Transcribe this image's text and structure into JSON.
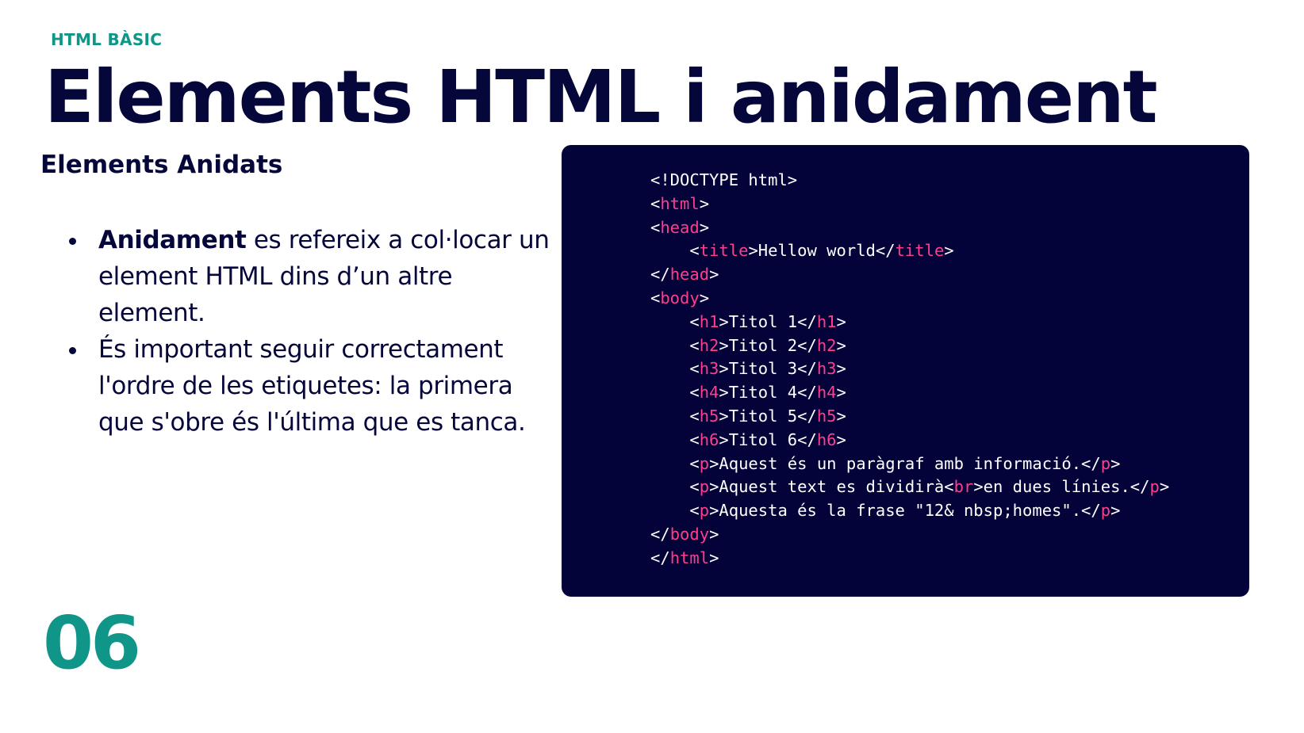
{
  "header": {
    "kicker": "HTML BÀSIC",
    "title": "Elements HTML i anidament"
  },
  "content": {
    "subtitle": "Elements Anidats",
    "bullets": [
      {
        "bold": "Anidament",
        "text": " es refereix a col·locar un element HTML dins d’un altre element."
      },
      {
        "bold": "",
        "text": "És important seguir correctament l'ordre de les etiquetes: la primera que s'obre és l'última que es tanca."
      }
    ]
  },
  "code_block": {
    "lines": [
      [
        "<!DOCTYPE html>"
      ],
      [
        "<",
        {
          "tag": "html"
        },
        ">"
      ],
      [
        "<",
        {
          "tag": "head"
        },
        ">"
      ],
      [
        "    <",
        {
          "tag": "title"
        },
        ">Hellow world</",
        {
          "tag": "title"
        },
        ">"
      ],
      [
        "</",
        {
          "tag": "head"
        },
        ">"
      ],
      [
        "<",
        {
          "tag": "body"
        },
        ">"
      ],
      [
        "    <",
        {
          "tag": "h1"
        },
        ">Titol 1</",
        {
          "tag": "h1"
        },
        ">"
      ],
      [
        "    <",
        {
          "tag": "h2"
        },
        ">Titol 2</",
        {
          "tag": "h2"
        },
        ">"
      ],
      [
        "    <",
        {
          "tag": "h3"
        },
        ">Titol 3</",
        {
          "tag": "h3"
        },
        ">"
      ],
      [
        "    <",
        {
          "tag": "h4"
        },
        ">Titol 4</",
        {
          "tag": "h4"
        },
        ">"
      ],
      [
        "    <",
        {
          "tag": "h5"
        },
        ">Titol 5</",
        {
          "tag": "h5"
        },
        ">"
      ],
      [
        "    <",
        {
          "tag": "h6"
        },
        ">Titol 6</",
        {
          "tag": "h6"
        },
        ">"
      ],
      [
        "    <",
        {
          "tag": "p"
        },
        ">Aquest és un paràgraf amb informació.</",
        {
          "tag": "p"
        },
        ">"
      ],
      [
        "    <",
        {
          "tag": "p"
        },
        ">Aquest text es dividirà<",
        {
          "tag": "br"
        },
        ">en dues línies.</",
        {
          "tag": "p"
        },
        ">"
      ],
      [
        "    <",
        {
          "tag": "p"
        },
        ">Aquesta és la frase \"12& nbsp;homes\".</",
        {
          "tag": "p"
        },
        ">"
      ],
      [
        "</",
        {
          "tag": "body"
        },
        ">"
      ],
      [
        "</",
        {
          "tag": "html"
        },
        ">"
      ]
    ]
  },
  "footer": {
    "page_number": "06"
  },
  "colors": {
    "accent": "#0f9688",
    "navy": "#05063a",
    "code_bg": "#03033a",
    "code_tag": "#ff3e8a"
  }
}
